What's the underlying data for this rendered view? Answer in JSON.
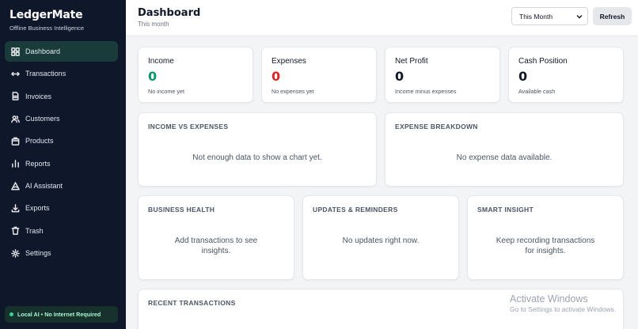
{
  "brand": {
    "name": "LedgerMate",
    "subtitle": "Offline Business Intelligence"
  },
  "nav": [
    {
      "label": "Dashboard",
      "icon": "dashboard-icon",
      "active": true
    },
    {
      "label": "Transactions",
      "icon": "transactions-icon"
    },
    {
      "label": "Invoices",
      "icon": "invoice-icon"
    },
    {
      "label": "Customers",
      "icon": "customers-icon"
    },
    {
      "label": "Products",
      "icon": "products-icon"
    },
    {
      "label": "Reports",
      "icon": "reports-icon"
    },
    {
      "label": "AI Assistant",
      "icon": "ai-assistant-icon"
    },
    {
      "label": "Exports",
      "icon": "export-icon"
    },
    {
      "label": "Trash",
      "icon": "trash-icon"
    },
    {
      "label": "Settings",
      "icon": "settings-icon"
    }
  ],
  "status": {
    "label": "Local AI • No Internet Required"
  },
  "header": {
    "title": "Dashboard",
    "subtitle": "This month",
    "period_selected": "This Month",
    "refresh_label": "Refresh"
  },
  "kpis": [
    {
      "label": "Income",
      "value": "0",
      "note": "No income yet",
      "color": "#059669"
    },
    {
      "label": "Expenses",
      "value": "0",
      "note": "No expenses yet",
      "color": "#dc2626"
    },
    {
      "label": "Net Profit",
      "value": "0",
      "note": "Income minus expenses",
      "color": "#111827"
    },
    {
      "label": "Cash Position",
      "value": "0",
      "note": "Available cash",
      "color": "#111827"
    }
  ],
  "sections": {
    "income_vs_expenses": {
      "title": "INCOME VS EXPENSES",
      "empty": "Not enough data to show a chart yet."
    },
    "expense_breakdown": {
      "title": "EXPENSE BREAKDOWN",
      "empty": "No expense data available."
    },
    "business_health": {
      "title": "BUSINESS HEALTH",
      "empty_line1": "Add transactions to see",
      "empty_line2": "insights."
    },
    "updates": {
      "title": "UPDATES & REMINDERS",
      "empty": "No updates right now."
    },
    "smart_insight": {
      "title": "SMART INSIGHT",
      "empty_line1": "Keep recording transactions",
      "empty_line2": "for insights."
    },
    "recent": {
      "title": "RECENT TRANSACTIONS"
    }
  },
  "watermark": {
    "line1": "Activate Windows",
    "line2": "Go to Settings to activate Windows."
  }
}
